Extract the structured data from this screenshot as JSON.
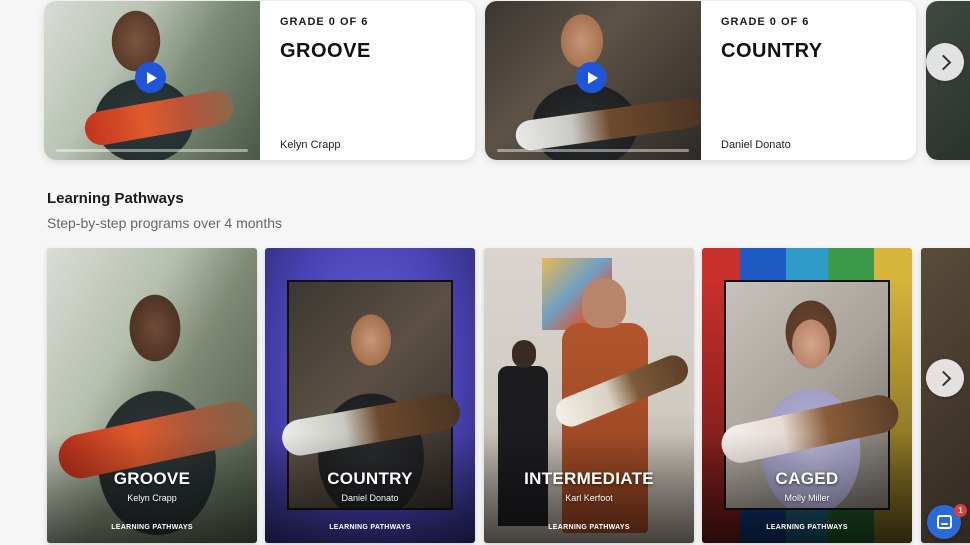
{
  "courses": [
    {
      "grade": "GRADE 0 OF 6",
      "title": "GROOVE",
      "instructor": "Kelyn Crapp",
      "progress": 0
    },
    {
      "grade": "GRADE 0 OF 6",
      "title": "COUNTRY",
      "instructor": "Daniel Donato",
      "progress": 0
    }
  ],
  "pathways": {
    "title": "Learning Pathways",
    "subtitle": "Step-by-step programs over 4 months",
    "items": [
      {
        "title": "GROOVE",
        "instructor": "Kelyn Crapp",
        "tag": "LEARNING PATHWAYS"
      },
      {
        "title": "COUNTRY",
        "instructor": "Daniel Donato",
        "tag": "LEARNING PATHWAYS"
      },
      {
        "title": "INTERMEDIATE",
        "instructor": "Karl Kerfoot",
        "tag": "LEARNING PATHWAYS"
      },
      {
        "title": "CAGED",
        "instructor": "Molly Miller",
        "tag": "LEARNING PATHWAYS"
      }
    ]
  },
  "chat": {
    "badge_count": "1"
  },
  "colors": {
    "accent": "#1f55d6",
    "chat": "#2a6ad8",
    "badge": "#e13b3b"
  }
}
